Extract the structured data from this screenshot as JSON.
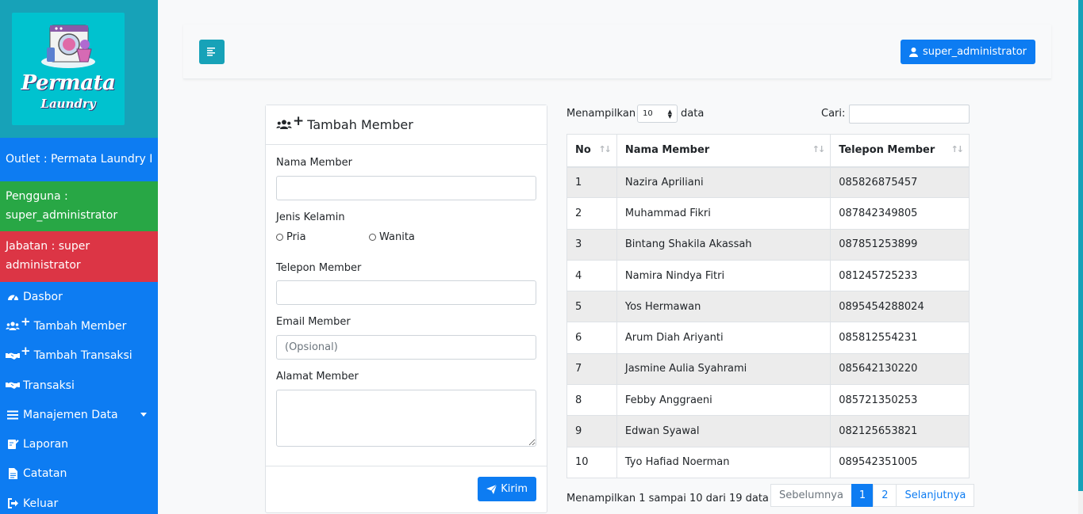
{
  "brand": {
    "title": "Permata",
    "subtitle": "Laundry"
  },
  "sidebar": {
    "outlet": "Outlet : Permata Laundry I",
    "user": "Pengguna : super_administrator",
    "role": "Jabatan : super administrator",
    "menu": [
      {
        "label": "Dasbor",
        "icon": "dashboard-icon"
      },
      {
        "label": "Tambah Member",
        "icon": "users-plus-icon"
      },
      {
        "label": "Tambah Transaksi",
        "icon": "handshake-plus-icon"
      },
      {
        "label": "Transaksi",
        "icon": "handshake-icon"
      },
      {
        "label": "Manajemen Data",
        "icon": "list-icon"
      },
      {
        "label": "Laporan",
        "icon": "report-icon"
      },
      {
        "label": "Catatan",
        "icon": "file-icon"
      },
      {
        "label": "Keluar",
        "icon": "logout-icon"
      }
    ]
  },
  "topbar": {
    "user_label": "super_administrator"
  },
  "form": {
    "title": "Tambah Member",
    "name_label": "Nama Member",
    "gender_label": "Jenis Kelamin",
    "gender_options": [
      "Pria",
      "Wanita"
    ],
    "phone_label": "Telepon Member",
    "email_label": "Email Member",
    "email_placeholder": "(Opsional)",
    "address_label": "Alamat Member",
    "submit_label": "Kirim"
  },
  "table": {
    "show_label": "Menampilkan",
    "page_size": "10",
    "data_label": "data",
    "search_label": "Cari:",
    "columns": [
      "No",
      "Nama Member",
      "Telepon Member"
    ],
    "rows": [
      [
        "1",
        "Nazira Apriliani",
        "085826875457"
      ],
      [
        "2",
        "Muhammad Fikri",
        "087842349805"
      ],
      [
        "3",
        "Bintang Shakila Akassah",
        "087851253899"
      ],
      [
        "4",
        "Namira Nindya Fitri",
        "081245725233"
      ],
      [
        "5",
        "Yos Hermawan",
        "0895454288024"
      ],
      [
        "6",
        "Arum Diah Ariyanti",
        "085812554231"
      ],
      [
        "7",
        "Jasmine Aulia Syahrami",
        "085642130220"
      ],
      [
        "8",
        "Febby Anggraeni",
        "085721350253"
      ],
      [
        "9",
        "Edwan Syawal",
        "082125653821"
      ],
      [
        "10",
        "Tyo Hafiad Noerman",
        "089542351005"
      ]
    ],
    "info": "Menampilkan 1 sampai 10 dari 19 data",
    "pager": {
      "prev": "Sebelumnya",
      "pages": [
        "1",
        "2"
      ],
      "next": "Selanjutnya"
    }
  },
  "colors": {
    "primary": "#0d7cf2",
    "info": "#17a2b8",
    "success": "#28a745",
    "danger": "#dc3545"
  }
}
